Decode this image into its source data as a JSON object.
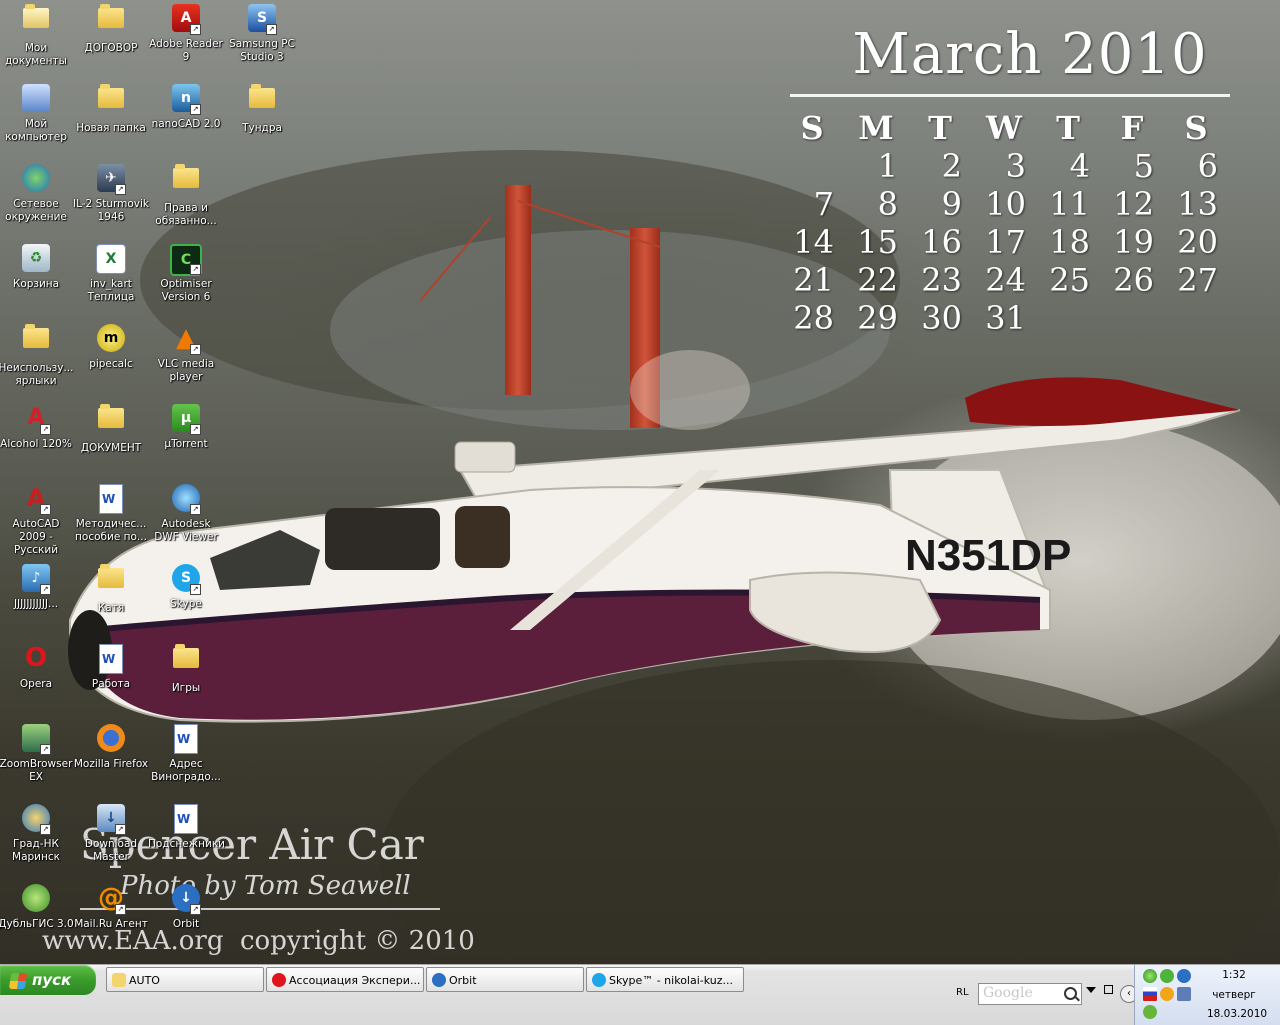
{
  "desktop": {
    "icons": [
      {
        "label": "Мои документы"
      },
      {
        "label": "ДОГОВОР"
      },
      {
        "label": "Adobe Reader 9"
      },
      {
        "label": "Samsung PC Studio 3"
      },
      {
        "label": "Мой компьютер"
      },
      {
        "label": "Новая папка"
      },
      {
        "label": "nanoCAD 2.0"
      },
      {
        "label": "Тундра"
      },
      {
        "label": "Сетевое окружение"
      },
      {
        "label": "IL-2 Sturmovik 1946"
      },
      {
        "label": "Права и обязанно..."
      },
      {
        "label": "Корзина"
      },
      {
        "label": "inv_kart Теплица"
      },
      {
        "label": "Optimiser Version 6"
      },
      {
        "label": "Неиспользу... ярлыки"
      },
      {
        "label": "pipecalc"
      },
      {
        "label": "VLC media player"
      },
      {
        "label": "Alcohol 120%"
      },
      {
        "label": "ДОКУМЕНТ"
      },
      {
        "label": "µTorrent"
      },
      {
        "label": "AutoCAD 2009 - Русский"
      },
      {
        "label": "Методичес... пособие по..."
      },
      {
        "label": "Autodesk DWF Viewer"
      },
      {
        "label": "JJJJJJJJJJJ..."
      },
      {
        "label": "Катя"
      },
      {
        "label": "Skype"
      },
      {
        "label": "Opera"
      },
      {
        "label": "Работа"
      },
      {
        "label": "Игры"
      },
      {
        "label": "ZoomBrowser EX"
      },
      {
        "label": "Mozilla Firefox"
      },
      {
        "label": "Адрес Виноградо..."
      },
      {
        "label": "Град-НК Маринск"
      },
      {
        "label": "Download Master"
      },
      {
        "label": "Подснежники"
      },
      {
        "label": "ДубльГИС 3.0"
      },
      {
        "label": "Mail.Ru Агент"
      },
      {
        "label": "Orbit"
      }
    ]
  },
  "wallpaper": {
    "tail_number": "N351DP",
    "calendar": {
      "title": "March 2010",
      "weekdays": [
        "S",
        "M",
        "T",
        "W",
        "T",
        "F",
        "S"
      ],
      "days": [
        "",
        "1",
        "2",
        "3",
        "4",
        "5",
        "6",
        "7",
        "8",
        "9",
        "10",
        "11",
        "12",
        "13",
        "14",
        "15",
        "16",
        "17",
        "18",
        "19",
        "20",
        "21",
        "22",
        "23",
        "24",
        "25",
        "26",
        "27",
        "28",
        "29",
        "30",
        "31"
      ]
    },
    "caption": {
      "title": "Spencer Air Car",
      "photo_credit": "Photo by Tom Seawell",
      "site": "www.EAA.org",
      "copyright": "copyright © 2010"
    }
  },
  "taskbar": {
    "start_label": "пуск",
    "tasks": [
      {
        "label": "AUTO"
      },
      {
        "label": "Ассоциация Экспери..."
      },
      {
        "label": "Orbit"
      },
      {
        "label": "Skype™ - nikolai-kuz..."
      }
    ],
    "language": "RL",
    "search_placeholder": "Google",
    "clock": {
      "time": "1:32",
      "day": "четверг",
      "date": "18.03.2010"
    }
  }
}
